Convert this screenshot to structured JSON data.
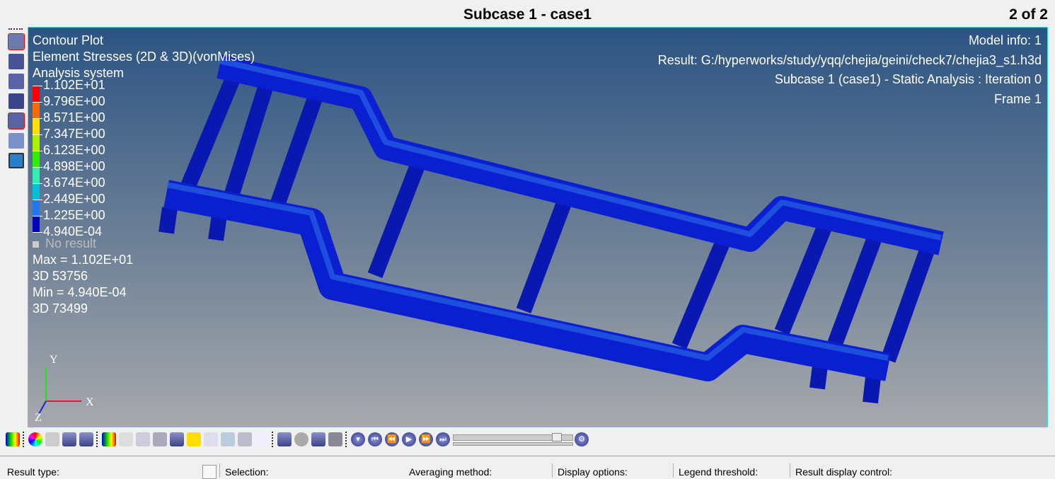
{
  "header": {
    "title": "Subcase 1 - case1",
    "pager": "2 of 2"
  },
  "viewport": {
    "top_left": [
      "Contour Plot",
      "Element Stresses (2D & 3D)(vonMises)",
      "Analysis system"
    ],
    "top_right": [
      "Model info: 1",
      "Result: G:/hyperworks/study/yqq/chejia/geini/check7/chejia3_s1.h3d",
      "Subcase 1 (case1) - Static Analysis : Iteration 0",
      "Frame 1"
    ],
    "legend": {
      "values": [
        "1.102E+01",
        "9.796E+00",
        "8.571E+00",
        "7.347E+00",
        "6.123E+00",
        "4.898E+00",
        "3.674E+00",
        "2.449E+00",
        "1.225E+00",
        "4.940E-04"
      ],
      "colors": [
        "#ff0000",
        "#ff6a00",
        "#ffe000",
        "#a8f000",
        "#30f000",
        "#30f0b0",
        "#00c0d8",
        "#1e78f0",
        "#0000c0"
      ],
      "no_result": "No result"
    },
    "stats": [
      "Max = 1.102E+01",
      "3D 53756",
      "Min = 4.940E-04",
      "3D 73499"
    ],
    "axes": {
      "y": "Y",
      "x": "X",
      "z": "Z"
    }
  },
  "panel": {
    "labels": [
      "Result type:",
      "Selection:",
      "Averaging method:",
      "Display options:",
      "Legend threshold:",
      "Result display control:"
    ]
  }
}
